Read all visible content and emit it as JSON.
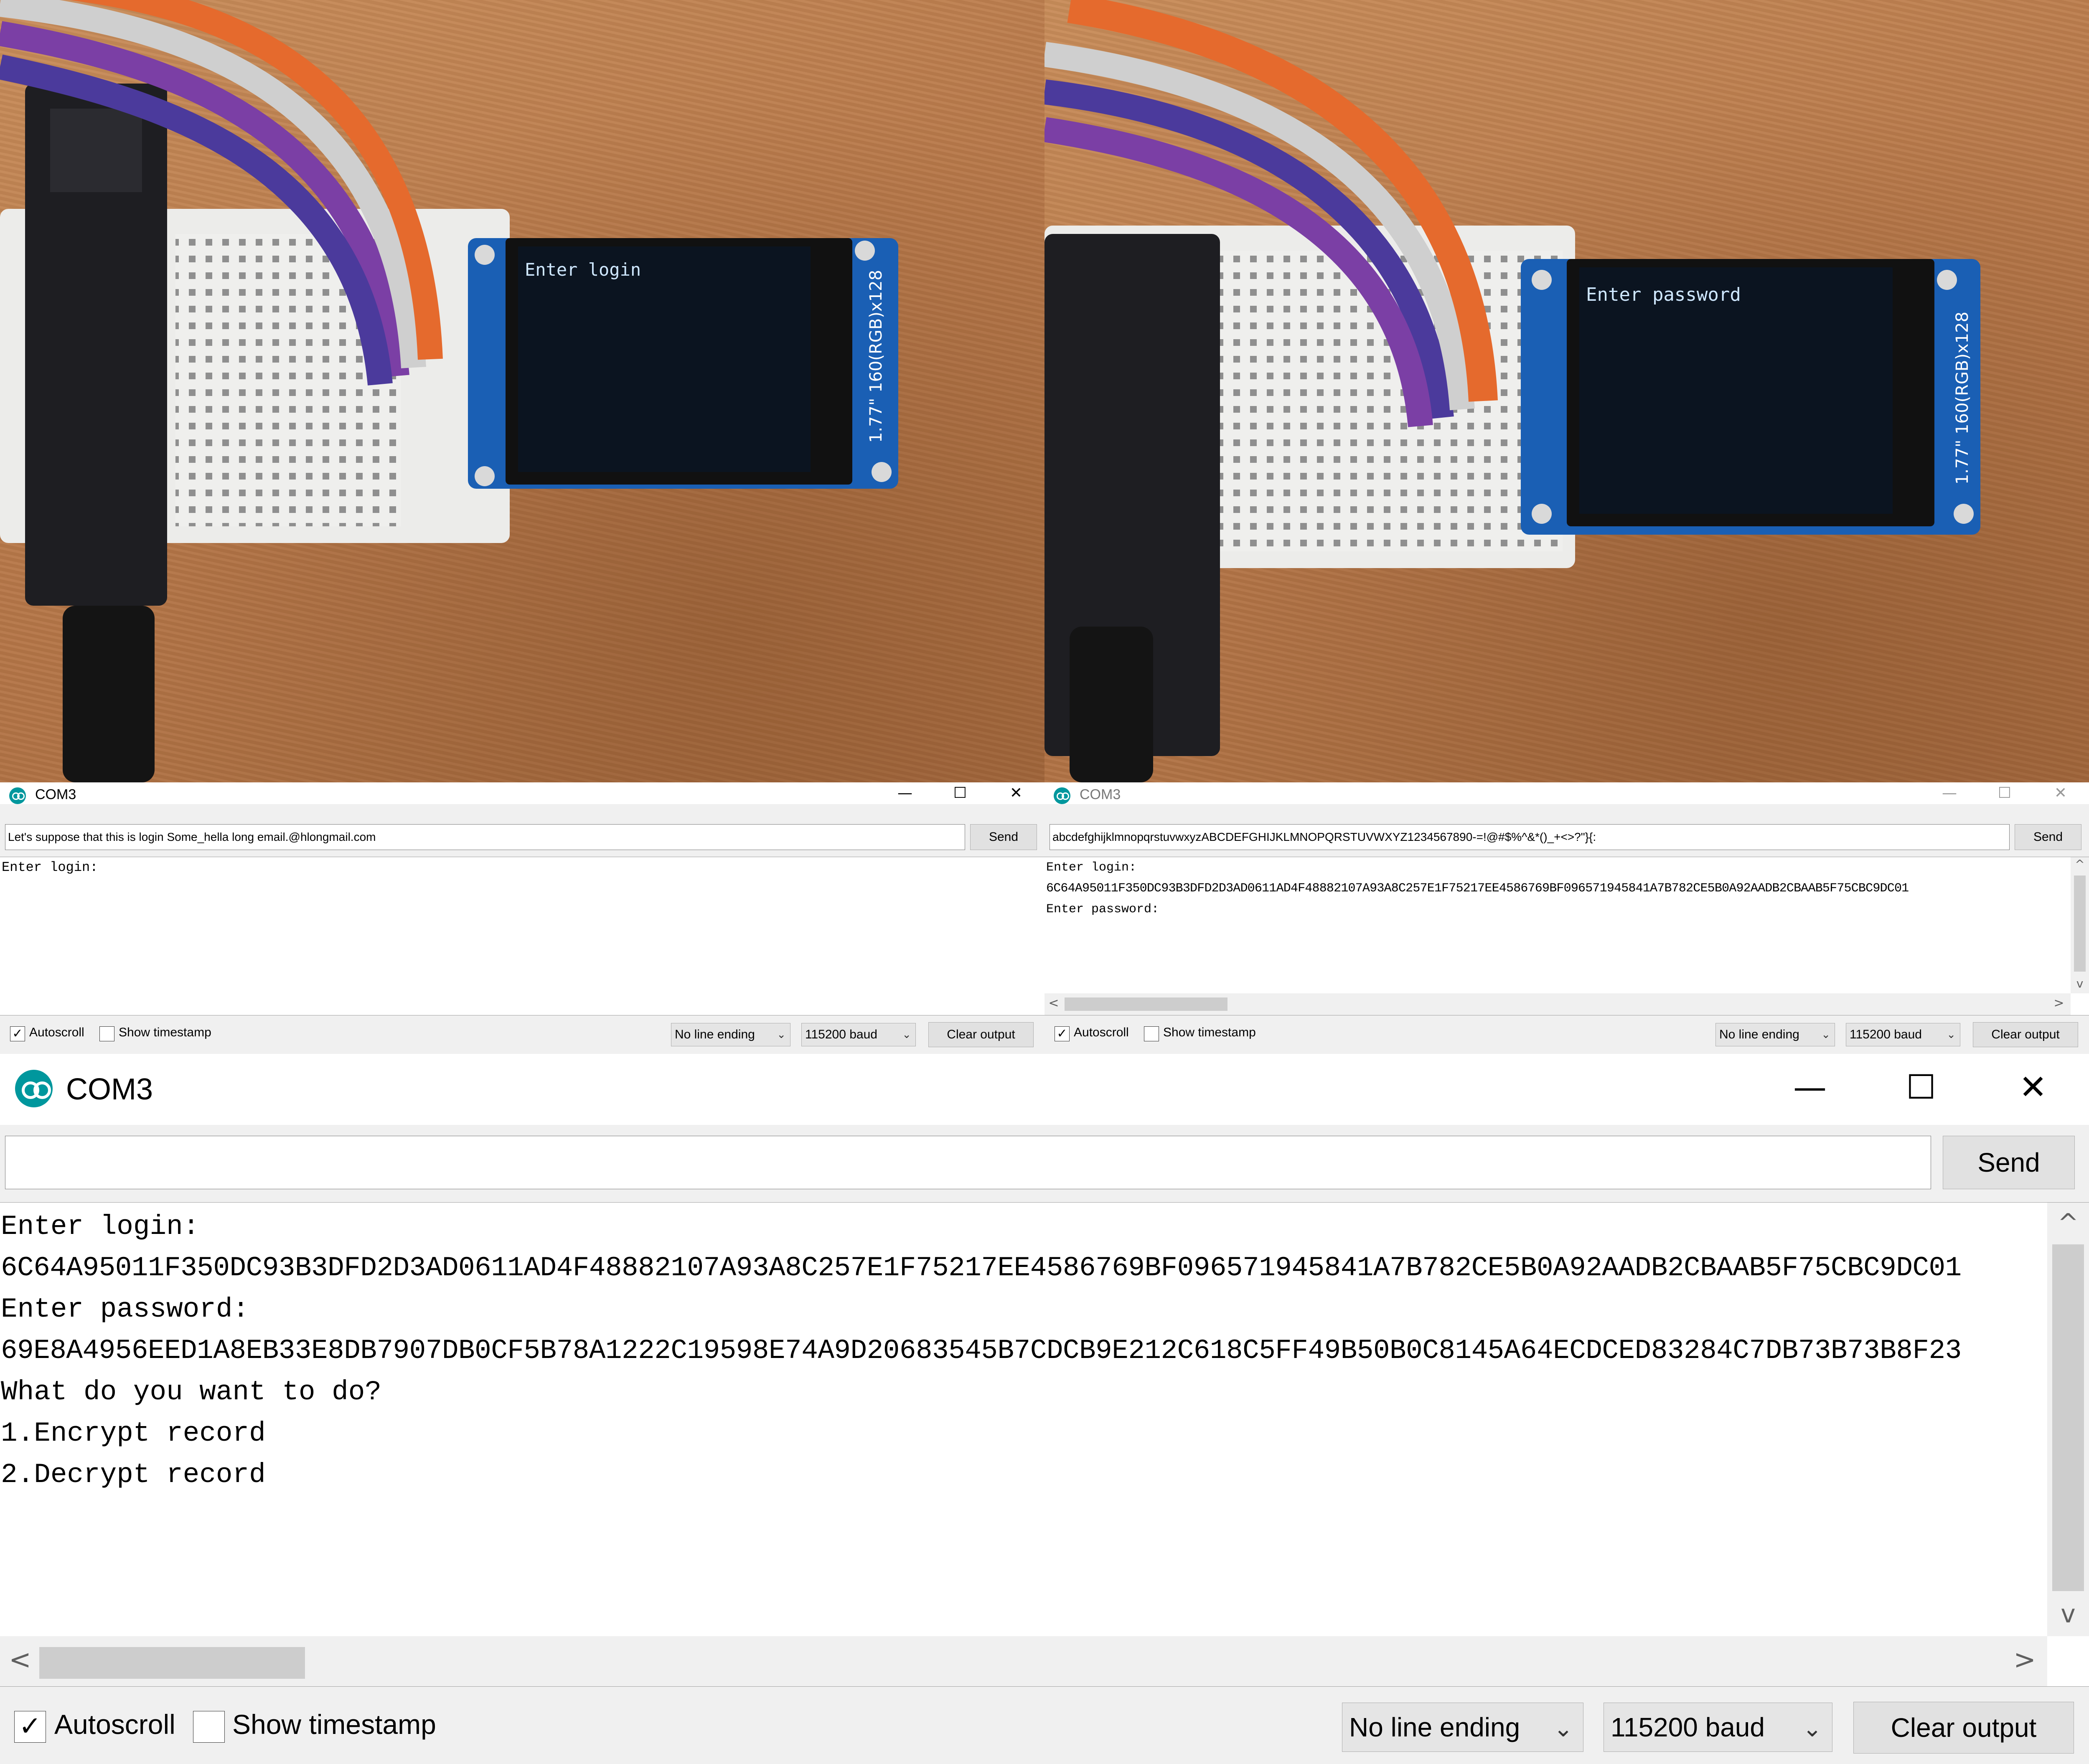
{
  "photo_left": {
    "lcd_text": "Enter login",
    "module_label": "1.77\" 160(RGB)x128"
  },
  "photo_right": {
    "lcd_text": "Enter password",
    "module_label": "1.77\" 160(RGB)x128"
  },
  "monitor_left": {
    "title": "COM3",
    "input_value": "Let's suppose that this is login Some_hella long email.@hlongmail.com",
    "send_label": "Send",
    "output_lines": [
      "Enter login:"
    ],
    "autoscroll_label": "Autoscroll",
    "autoscroll_checked": "✓",
    "timestamp_label": "Show timestamp",
    "line_ending": "No line ending",
    "baud": "115200 baud",
    "clear_label": "Clear output"
  },
  "monitor_right": {
    "title": "COM3",
    "input_value": "abcdefghijklmnopqrstuvwxyzABCDEFGHIJKLMNOPQRSTUVWXYZ1234567890-=!@#$%^&*()_+<>?\"}{:",
    "send_label": "Send",
    "output_lines": [
      "Enter login:",
      "6C64A95011F350DC93B3DFD2D3AD0611AD4F48882107A93A8C257E1F75217EE4586769BF096571945841A7B782CE5B0A92AADB2CBAAB5F75CBC9DC01",
      "Enter password:"
    ],
    "autoscroll_label": "Autoscroll",
    "autoscroll_checked": "✓",
    "timestamp_label": "Show timestamp",
    "line_ending": "No line ending",
    "baud": "115200 baud",
    "clear_label": "Clear output"
  },
  "monitor_main": {
    "title": "COM3",
    "input_value": "",
    "send_label": "Send",
    "output_lines": [
      "Enter login:",
      "6C64A95011F350DC93B3DFD2D3AD0611AD4F48882107A93A8C257E1F75217EE4586769BF096571945841A7B782CE5B0A92AADB2CBAAB5F75CBC9DC01",
      "Enter password:",
      "69E8A4956EED1A8EB33E8DB7907DB0CF5B78A1222C19598E74A9D20683545B7CDCB9E212C618C5FF49B50B0C8145A64ECDCED83284C7DB73B73B8F23",
      "What do you want to do?",
      "1.Encrypt record",
      "2.Decrypt record"
    ],
    "autoscroll_label": "Autoscroll",
    "autoscroll_checked": "✓",
    "timestamp_label": "Show timestamp",
    "line_ending": "No line ending",
    "baud": "115200 baud",
    "clear_label": "Clear output"
  },
  "window_controls": {
    "minimize": "—",
    "maximize": "☐",
    "close": "✕"
  },
  "scroll_glyphs": {
    "up": "^",
    "down": "v",
    "left": "<",
    "right": ">",
    "chevron": "⌄"
  },
  "colors": {
    "arduino_teal": "#00979d",
    "lcd_text": "#cfe8ff",
    "window_bg": "#f0f0f0"
  }
}
